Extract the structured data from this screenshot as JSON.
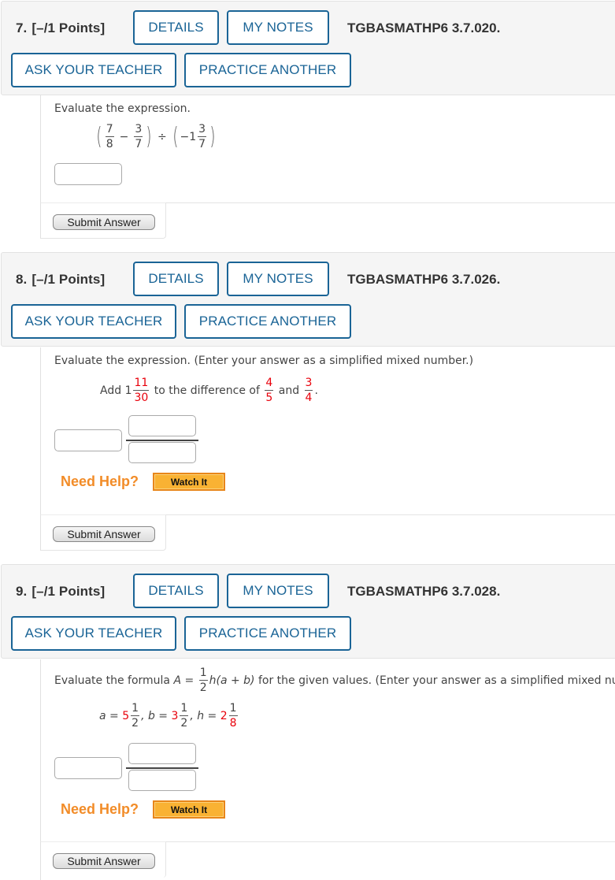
{
  "questions": [
    {
      "number": "7.",
      "points": "[–/1 Points]",
      "details_label": "DETAILS",
      "notes_label": "MY NOTES",
      "code": "TGBASMATHP6 3.7.020.",
      "ask_label": "ASK YOUR TEACHER",
      "practice_label": "PRACTICE ANOTHER",
      "prompt": "Evaluate the expression.",
      "expression": {
        "f1_num": "7",
        "f1_den": "8",
        "minus": "−",
        "f2_num": "3",
        "f2_den": "7",
        "divide": "÷",
        "mixed_whole": "−1",
        "f3_num": "3",
        "f3_den": "7"
      },
      "answer_value": "",
      "submit_label": "Submit Answer"
    },
    {
      "number": "8.",
      "points": "[–/1 Points]",
      "details_label": "DETAILS",
      "notes_label": "MY NOTES",
      "code": "TGBASMATHP6 3.7.026.",
      "ask_label": "ASK YOUR TEACHER",
      "practice_label": "PRACTICE ANOTHER",
      "prompt": "Evaluate the expression. (Enter your answer as a simplified mixed number.)",
      "expression": {
        "add": "Add",
        "whole": "1",
        "f1_num": "11",
        "f1_den": "30",
        "middle": "to the difference of",
        "f2_num": "4",
        "f2_den": "5",
        "and": "and",
        "f3_num": "3",
        "f3_den": "4",
        "end": "."
      },
      "answer_whole": "",
      "answer_num": "",
      "answer_den": "",
      "help_label": "Need Help?",
      "watch_label": "Watch It",
      "submit_label": "Submit Answer"
    },
    {
      "number": "9.",
      "points": "[–/1 Points]",
      "details_label": "DETAILS",
      "notes_label": "MY NOTES",
      "code": "TGBASMATHP6 3.7.028.",
      "ask_label": "ASK YOUR TEACHER",
      "practice_label": "PRACTICE ANOTHER",
      "prompt_pre": "Evaluate the formula",
      "formula": {
        "A": "A",
        "eq": "=",
        "num": "1",
        "den": "2",
        "rest_h": "h",
        "rest": "(a + b)"
      },
      "prompt_post": "for the given values. (Enter your answer as a simplified mixed number.)",
      "values": {
        "a_label": "a =",
        "a_whole": "5",
        "a_num": "1",
        "a_den": "2",
        "b_label": ", b =",
        "b_whole": "3",
        "b_num": "1",
        "b_den": "2",
        "h_label": ", h =",
        "h_whole": "2",
        "h_num": "1",
        "h_den": "8"
      },
      "answer_whole": "",
      "answer_num": "",
      "answer_den": "",
      "help_label": "Need Help?",
      "watch_label": "Watch It",
      "submit_label": "Submit Answer"
    }
  ],
  "colors": {
    "accent_blue": "#1a6496",
    "help_orange": "#f28c28",
    "watch_button": "#f9b233",
    "highlight_red": "#e8000b"
  }
}
